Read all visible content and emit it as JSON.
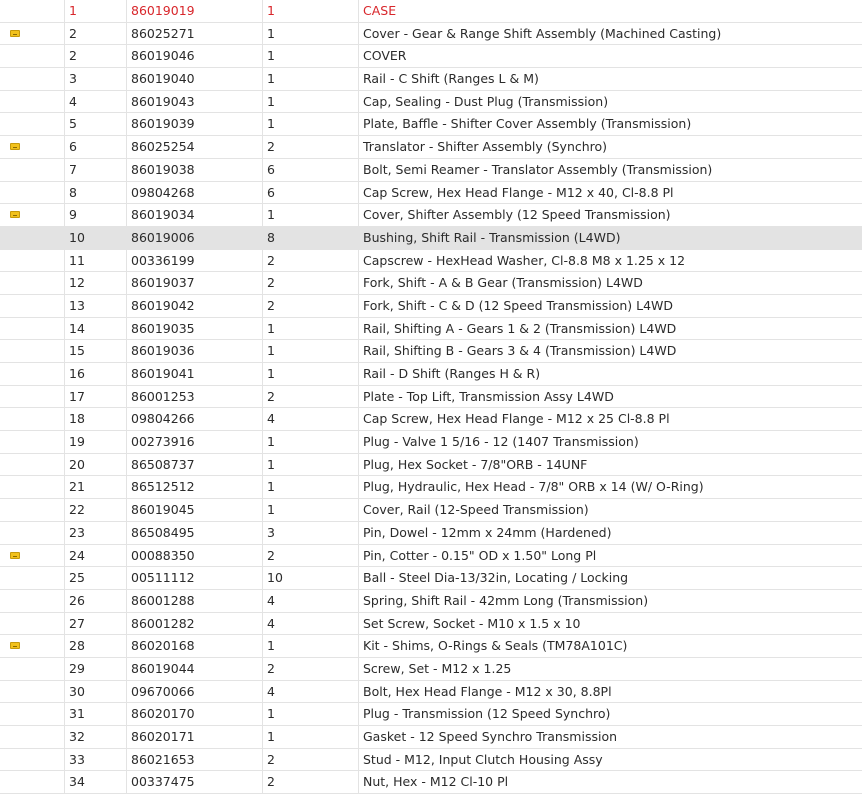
{
  "colors": {
    "highlight": "#d8262b",
    "selected_row": "#e3e3e3",
    "note_icon": "#f2c21d"
  },
  "rows": [
    {
      "ref": "1",
      "part": "86019019",
      "qty": "1",
      "desc": "CASE",
      "note": false,
      "highlight": true
    },
    {
      "ref": "2",
      "part": "86025271",
      "qty": "1",
      "desc": "Cover - Gear & Range Shift Assembly (Machined Casting)",
      "note": true
    },
    {
      "ref": "2",
      "part": "86019046",
      "qty": "1",
      "desc": "COVER",
      "note": false
    },
    {
      "ref": "3",
      "part": "86019040",
      "qty": "1",
      "desc": "Rail - C Shift (Ranges L & M)",
      "note": false
    },
    {
      "ref": "4",
      "part": "86019043",
      "qty": "1",
      "desc": "Cap, Sealing - Dust Plug (Transmission)",
      "note": false
    },
    {
      "ref": "5",
      "part": "86019039",
      "qty": "1",
      "desc": "Plate, Baffle - Shifter Cover Assembly (Transmission)",
      "note": false
    },
    {
      "ref": "6",
      "part": "86025254",
      "qty": "2",
      "desc": "Translator - Shifter Assembly (Synchro)",
      "note": true
    },
    {
      "ref": "7",
      "part": "86019038",
      "qty": "6",
      "desc": "Bolt, Semi Reamer - Translator Assembly (Transmission)",
      "note": false
    },
    {
      "ref": "8",
      "part": "09804268",
      "qty": "6",
      "desc": "Cap Screw, Hex Head Flange - M12 x 40, Cl-8.8 Pl",
      "note": false
    },
    {
      "ref": "9",
      "part": "86019034",
      "qty": "1",
      "desc": "Cover, Shifter Assembly (12 Speed Transmission)",
      "note": true
    },
    {
      "ref": "10",
      "part": "86019006",
      "qty": "8",
      "desc": "Bushing, Shift Rail - Transmission (L4WD)",
      "note": false,
      "selected": true
    },
    {
      "ref": "11",
      "part": "00336199",
      "qty": "2",
      "desc": "Capscrew - HexHead Washer, Cl-8.8 M8 x 1.25 x 12",
      "note": false
    },
    {
      "ref": "12",
      "part": "86019037",
      "qty": "2",
      "desc": "Fork, Shift - A & B Gear (Transmission) L4WD",
      "note": false
    },
    {
      "ref": "13",
      "part": "86019042",
      "qty": "2",
      "desc": "Fork, Shift - C & D (12 Speed Transmission) L4WD",
      "note": false
    },
    {
      "ref": "14",
      "part": "86019035",
      "qty": "1",
      "desc": "Rail, Shifting A - Gears 1 & 2 (Transmission) L4WD",
      "note": false
    },
    {
      "ref": "15",
      "part": "86019036",
      "qty": "1",
      "desc": "Rail, Shifting B - Gears 3 & 4 (Transmission) L4WD",
      "note": false
    },
    {
      "ref": "16",
      "part": "86019041",
      "qty": "1",
      "desc": "Rail - D Shift (Ranges H & R)",
      "note": false
    },
    {
      "ref": "17",
      "part": "86001253",
      "qty": "2",
      "desc": "Plate - Top Lift, Transmission Assy L4WD",
      "note": false
    },
    {
      "ref": "18",
      "part": "09804266",
      "qty": "4",
      "desc": "Cap Screw, Hex Head Flange - M12 x 25 Cl-8.8 Pl",
      "note": false
    },
    {
      "ref": "19",
      "part": "00273916",
      "qty": "1",
      "desc": "Plug - Valve 1 5/16 - 12 (1407 Transmission)",
      "note": false
    },
    {
      "ref": "20",
      "part": "86508737",
      "qty": "1",
      "desc": "Plug, Hex Socket - 7/8\"ORB - 14UNF",
      "note": false
    },
    {
      "ref": "21",
      "part": "86512512",
      "qty": "1",
      "desc": "Plug, Hydraulic, Hex Head - 7/8\" ORB x 14 (W/ O-Ring)",
      "note": false
    },
    {
      "ref": "22",
      "part": "86019045",
      "qty": "1",
      "desc": "Cover, Rail (12-Speed Transmission)",
      "note": false
    },
    {
      "ref": "23",
      "part": "86508495",
      "qty": "3",
      "desc": "Pin, Dowel - 12mm x 24mm (Hardened)",
      "note": false
    },
    {
      "ref": "24",
      "part": "00088350",
      "qty": "2",
      "desc": "Pin, Cotter - 0.15\" OD x 1.50\" Long Pl",
      "note": true
    },
    {
      "ref": "25",
      "part": "00511112",
      "qty": "10",
      "desc": "Ball - Steel Dia-13/32in, Locating / Locking",
      "note": false
    },
    {
      "ref": "26",
      "part": "86001288",
      "qty": "4",
      "desc": "Spring, Shift Rail - 42mm Long (Transmission)",
      "note": false
    },
    {
      "ref": "27",
      "part": "86001282",
      "qty": "4",
      "desc": "Set Screw, Socket - M10 x 1.5 x 10",
      "note": false
    },
    {
      "ref": "28",
      "part": "86020168",
      "qty": "1",
      "desc": "Kit - Shims, O-Rings & Seals (TM78A101C)",
      "note": true
    },
    {
      "ref": "29",
      "part": "86019044",
      "qty": "2",
      "desc": "Screw, Set - M12 x 1.25",
      "note": false
    },
    {
      "ref": "30",
      "part": "09670066",
      "qty": "4",
      "desc": "Bolt, Hex Head Flange - M12 x 30, 8.8Pl",
      "note": false
    },
    {
      "ref": "31",
      "part": "86020170",
      "qty": "1",
      "desc": "Plug - Transmission (12 Speed Synchro)",
      "note": false
    },
    {
      "ref": "32",
      "part": "86020171",
      "qty": "1",
      "desc": "Gasket - 12 Speed Synchro Transmission",
      "note": false
    },
    {
      "ref": "33",
      "part": "86021653",
      "qty": "2",
      "desc": "Stud - M12, Input Clutch Housing Assy",
      "note": false
    },
    {
      "ref": "34",
      "part": "00337475",
      "qty": "2",
      "desc": "Nut, Hex - M12 Cl-10 Pl",
      "note": false
    }
  ]
}
